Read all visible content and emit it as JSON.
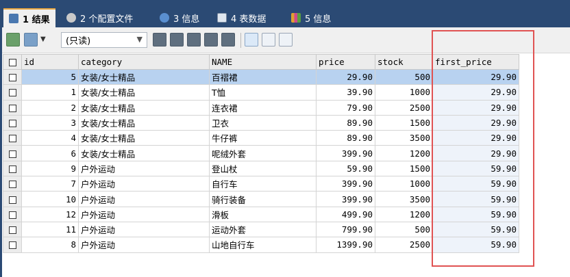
{
  "tabs": [
    {
      "label": "1 结果",
      "icon": "results-grid-icon",
      "active": true
    },
    {
      "label": "2 个配置文件",
      "icon": "profile-icon",
      "active": false
    },
    {
      "label": "3 信息",
      "icon": "info-icon",
      "active": false
    },
    {
      "label": "4 表数据",
      "icon": "table-data-icon",
      "active": false
    },
    {
      "label": "5 信息",
      "icon": "info-chart-icon",
      "active": false
    }
  ],
  "toolbar": {
    "mode_value": "(只读)",
    "icons": [
      "export-icon",
      "import-icon",
      "add-row-icon",
      "duplicate-row-icon",
      "save-icon",
      "delete-icon",
      "cancel-icon",
      "grid-view-icon",
      "form-view-icon",
      "text-view-icon"
    ]
  },
  "table": {
    "columns": [
      "id",
      "category",
      "NAME",
      "price",
      "stock",
      "first_price"
    ],
    "rows": [
      [
        "5",
        "女装/女士精品",
        "百褶裙",
        "29.90",
        "500",
        "29.90"
      ],
      [
        "1",
        "女装/女士精品",
        "T恤",
        "39.90",
        "1000",
        "29.90"
      ],
      [
        "2",
        "女装/女士精品",
        "连衣裙",
        "79.90",
        "2500",
        "29.90"
      ],
      [
        "3",
        "女装/女士精品",
        "卫衣",
        "89.90",
        "1500",
        "29.90"
      ],
      [
        "4",
        "女装/女士精品",
        "牛仔裤",
        "89.90",
        "3500",
        "29.90"
      ],
      [
        "6",
        "女装/女士精品",
        "呢绒外套",
        "399.90",
        "1200",
        "29.90"
      ],
      [
        "9",
        "户外运动",
        "登山杖",
        "59.90",
        "1500",
        "59.90"
      ],
      [
        "7",
        "户外运动",
        "自行车",
        "399.90",
        "1000",
        "59.90"
      ],
      [
        "10",
        "户外运动",
        "骑行装备",
        "399.90",
        "3500",
        "59.90"
      ],
      [
        "12",
        "户外运动",
        "滑板",
        "499.90",
        "1200",
        "59.90"
      ],
      [
        "11",
        "户外运动",
        "运动外套",
        "799.90",
        "500",
        "59.90"
      ],
      [
        "8",
        "户外运动",
        "山地自行车",
        "1399.90",
        "2500",
        "59.90"
      ]
    ]
  },
  "colors": {
    "highlight": "#e05252",
    "selected_row": "#b8d2f0",
    "tab_bar": "#2b4a74"
  }
}
